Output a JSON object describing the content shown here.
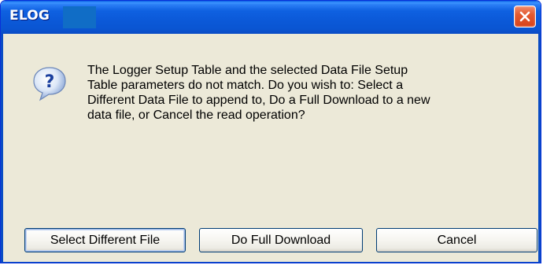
{
  "window": {
    "title": "ELOG",
    "close_icon": "close-icon"
  },
  "dialog": {
    "icon": "question-icon",
    "message_lines": [
      "The Logger Setup Table and the selected Data File Setup",
      "Table parameters do not match. Do you wish to: Select a",
      "Different Data File to append to, Do a Full Download to a new",
      "data file, or Cancel the read operation?"
    ]
  },
  "buttons": {
    "select_different_file": "Select Different File",
    "do_full_download": "Do Full Download",
    "cancel": "Cancel"
  },
  "colors": {
    "titlebar": "#0a55d2",
    "dialog_background": "#ece9d8",
    "close_button": "#d8431a",
    "redaction_box": "#106dc6"
  }
}
